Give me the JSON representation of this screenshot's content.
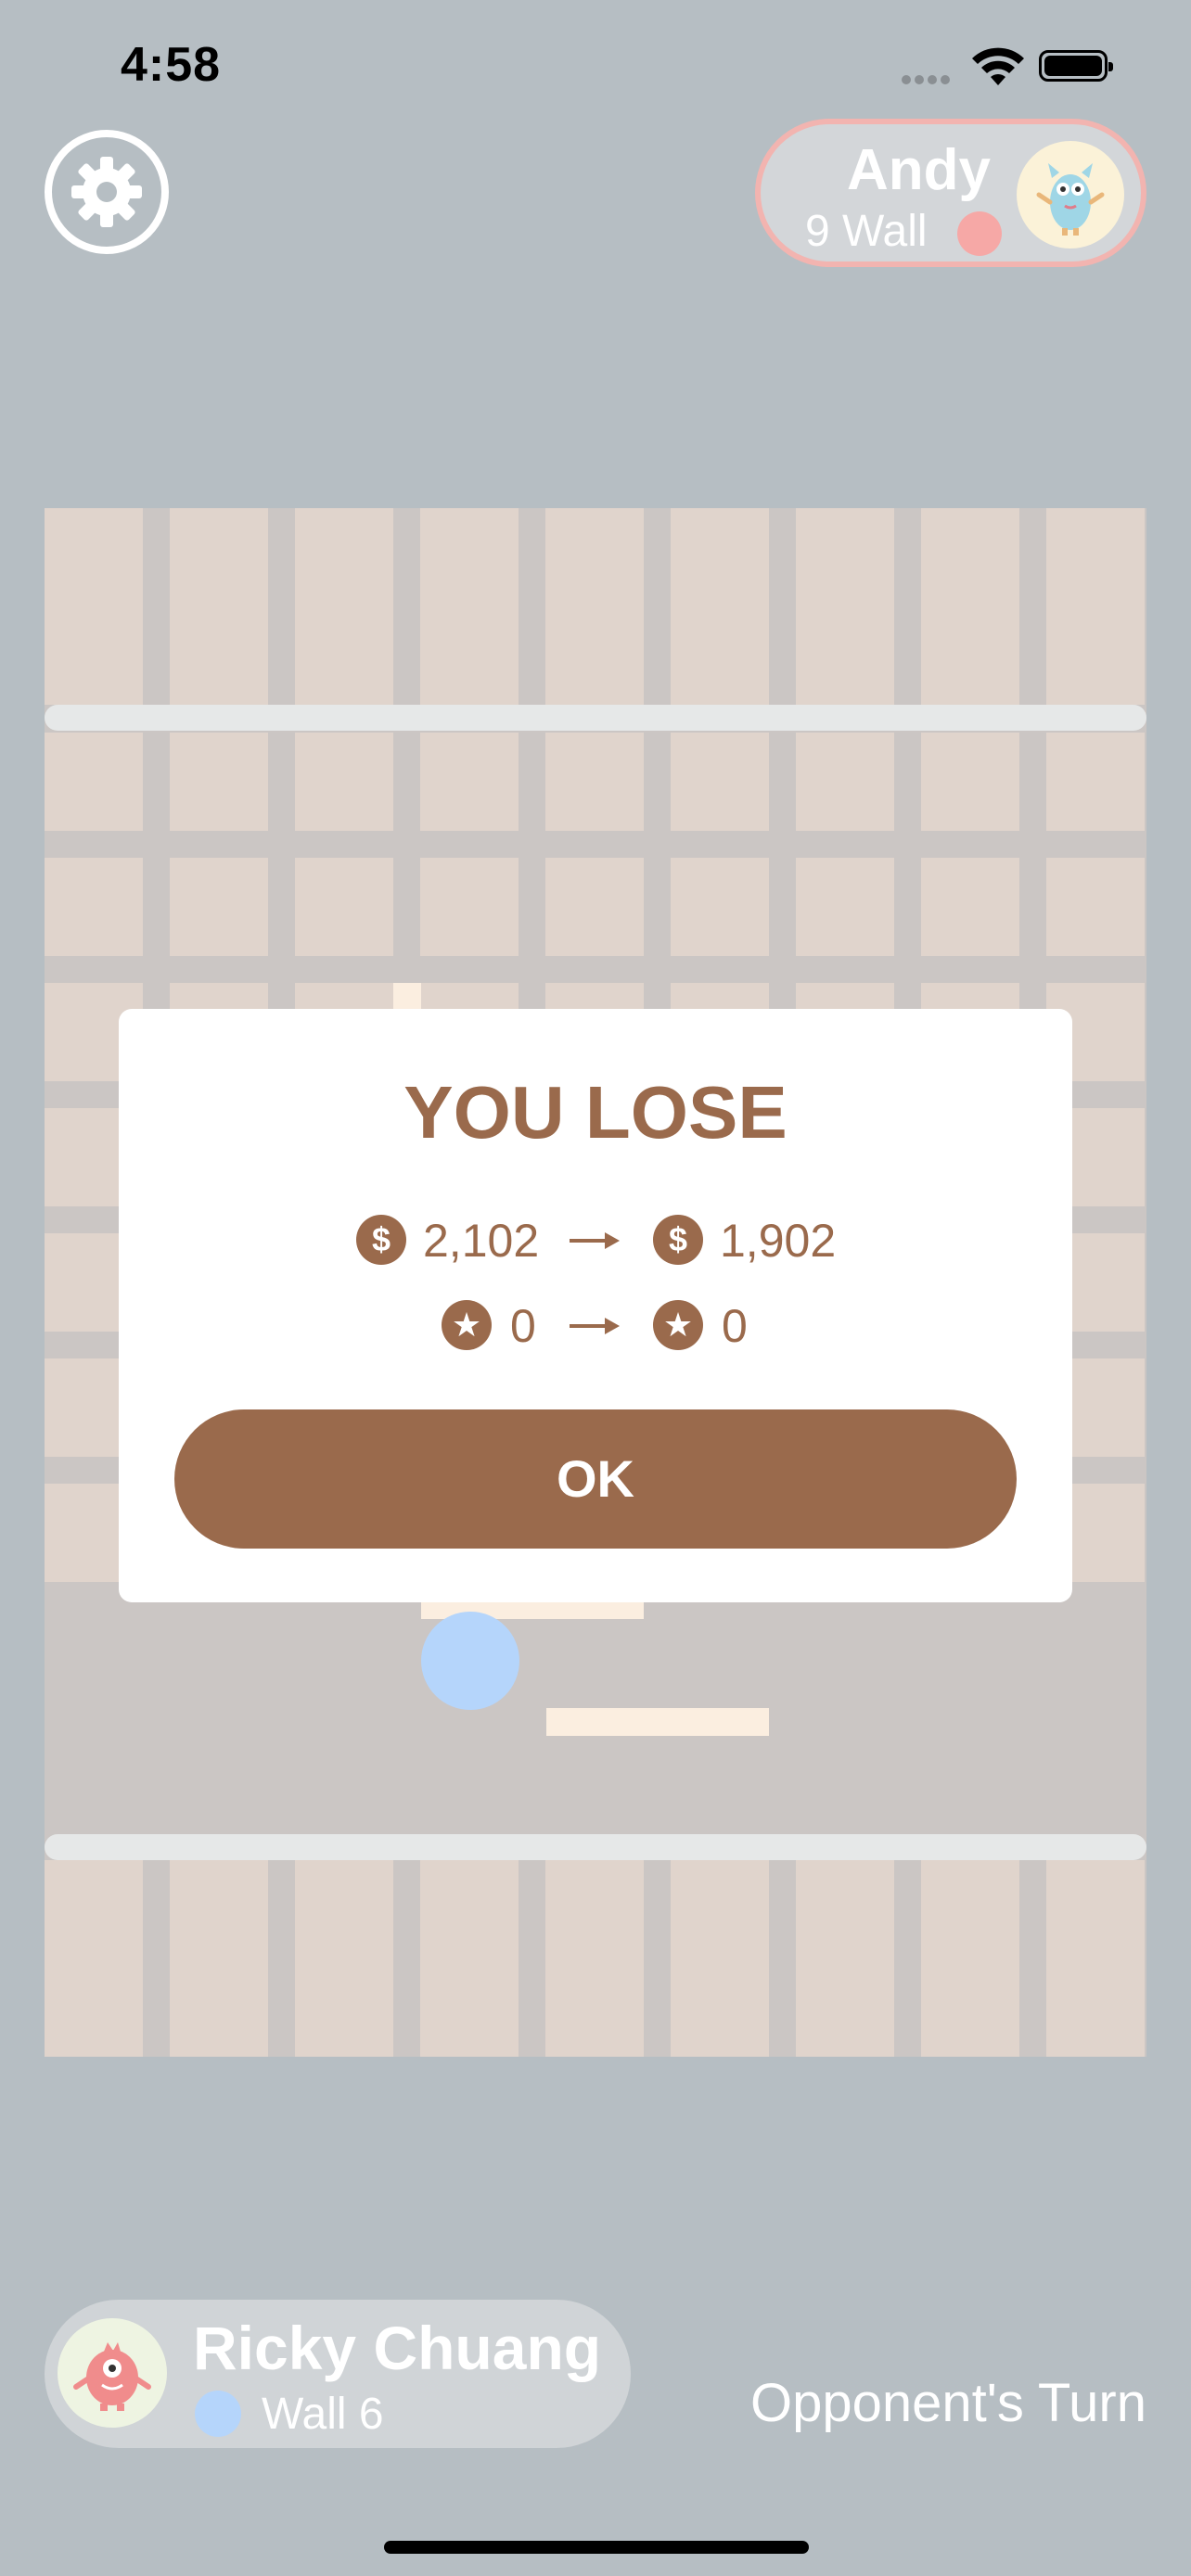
{
  "status": {
    "time": "4:58"
  },
  "opponent": {
    "name": "Andy",
    "walls_label": "9 Wall",
    "color": "#f6a8a6",
    "avatar_icon": "blue-monster-icon"
  },
  "player": {
    "name": "Ricky Chuang",
    "walls_label": "Wall 6",
    "color": "#b5d5fb",
    "avatar_icon": "pink-monster-icon"
  },
  "turn_label": "Opponent's Turn",
  "modal": {
    "title": "YOU LOSE",
    "coins": {
      "icon": "$",
      "from": "2,102",
      "to": "1,902"
    },
    "stars": {
      "icon": "★",
      "from": "0",
      "to": "0"
    },
    "ok_label": "OK"
  },
  "colors": {
    "accent": "#9a6a4c",
    "background": "#b6bec3",
    "cell": "#e0d4cc",
    "groove": "#cbc6c4",
    "placed_wall": "#fbeee0"
  }
}
